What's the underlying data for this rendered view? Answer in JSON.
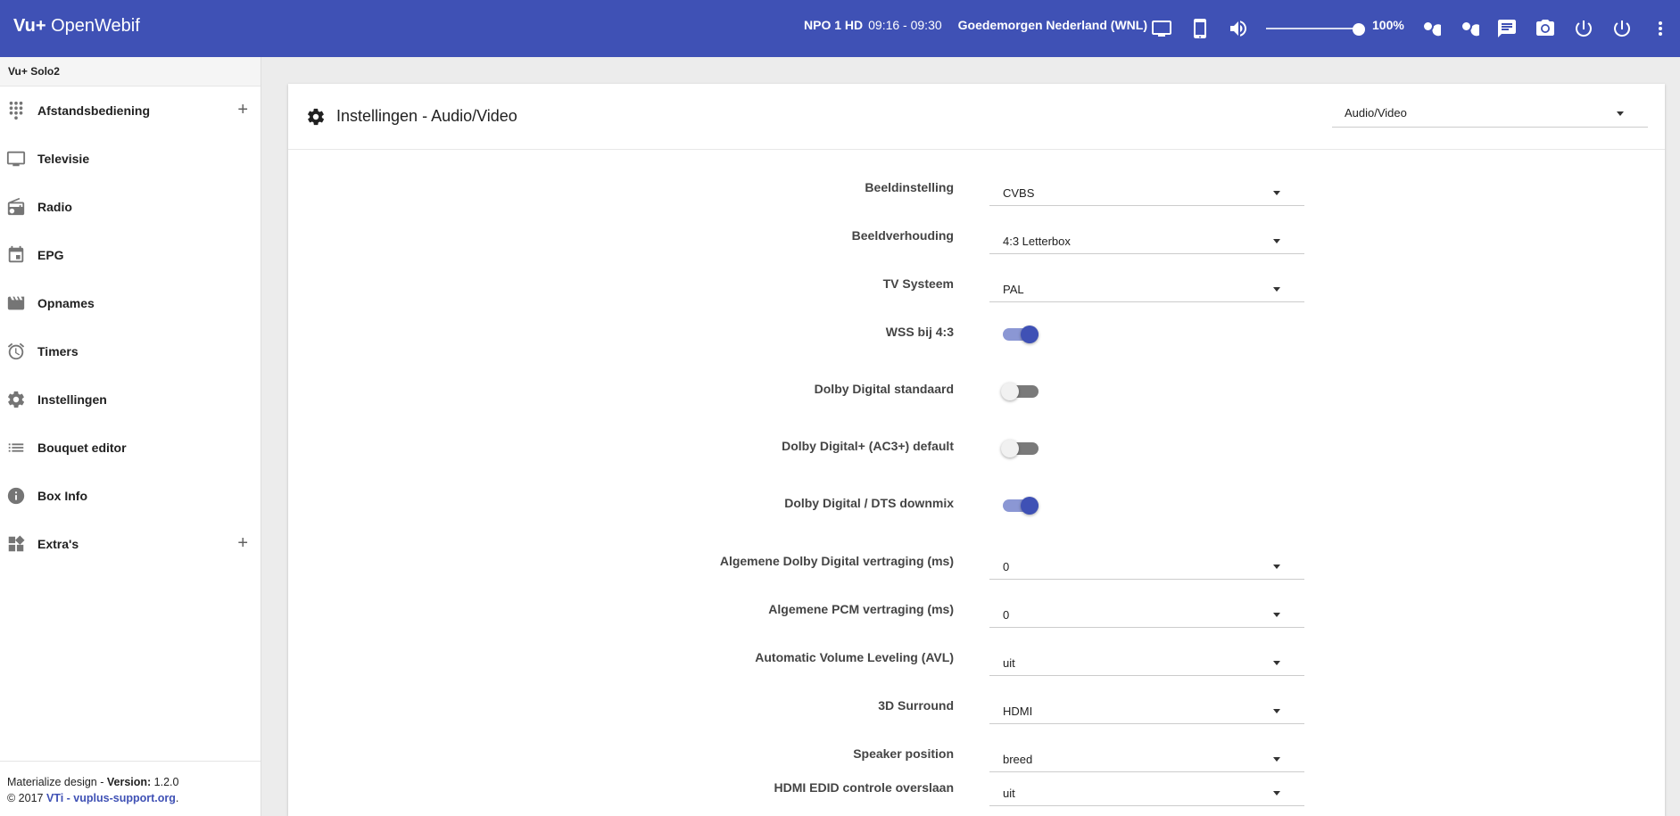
{
  "header": {
    "brand_bold": "Vu+",
    "brand_rest": "OpenWebif",
    "channel": "NPO 1 HD",
    "time": "09:16 - 09:30",
    "event": "Goedemorgen Nederland (WNL)",
    "volume_level": 100,
    "volume_label": "100%",
    "icons": [
      "tv-icon",
      "phone-icon",
      "volume-icon",
      "search-icon",
      "zoom-out-icon",
      "message-icon",
      "camera-icon",
      "power-icon",
      "power-standby-icon",
      "more-vert-icon"
    ],
    "color": "#3f51b5"
  },
  "sidebar": {
    "box_name": "Vu+ Solo2",
    "items": [
      {
        "label": "Afstandsbediening",
        "icon": "dialpad-icon",
        "expandable": true
      },
      {
        "label": "Televisie",
        "icon": "tv-icon"
      },
      {
        "label": "Radio",
        "icon": "radio-icon"
      },
      {
        "label": "EPG",
        "icon": "calendar-icon"
      },
      {
        "label": "Opnames",
        "icon": "movie-icon"
      },
      {
        "label": "Timers",
        "icon": "alarm-icon"
      },
      {
        "label": "Instellingen",
        "icon": "gear-icon"
      },
      {
        "label": "Bouquet editor",
        "icon": "list-icon"
      },
      {
        "label": "Box Info",
        "icon": "info-icon"
      },
      {
        "label": "Extra's",
        "icon": "widgets-icon",
        "expandable": true
      }
    ],
    "plus_symbol": "+",
    "footer": {
      "design": "Materialize design - ",
      "version_label": "Version:",
      "version": " 1.2.0",
      "copyright": "© 2017 ",
      "link": "VTi - vuplus-support.org",
      "dot": "."
    }
  },
  "main": {
    "title": "Instellingen - Audio/Video",
    "section_select": "Audio/Video",
    "settings": [
      {
        "label": "Beeldinstelling",
        "type": "select",
        "value": "CVBS"
      },
      {
        "label": "Beeldverhouding",
        "type": "select",
        "value": "4:3 Letterbox"
      },
      {
        "label": "TV Systeem",
        "type": "select",
        "value": "PAL"
      },
      {
        "label": "WSS bij 4:3",
        "type": "toggle",
        "on": true
      },
      {
        "label": "Dolby Digital standaard",
        "type": "toggle",
        "on": false
      },
      {
        "label": "Dolby Digital+ (AC3+) default",
        "type": "toggle",
        "on": false
      },
      {
        "label": "Dolby Digital / DTS downmix",
        "type": "toggle",
        "on": true
      },
      {
        "label": "Algemene Dolby Digital vertraging (ms)",
        "type": "select",
        "value": "0"
      },
      {
        "label": "Algemene PCM vertraging (ms)",
        "type": "select",
        "value": "0"
      },
      {
        "label": "Automatic Volume Leveling (AVL)",
        "type": "select",
        "value": "uit"
      },
      {
        "label": "3D Surround",
        "type": "select",
        "value": "HDMI"
      },
      {
        "label": "Speaker position",
        "type": "select",
        "value": "breed"
      },
      {
        "label": "HDMI EDID controle overslaan",
        "type": "select",
        "value": "uit"
      }
    ]
  }
}
